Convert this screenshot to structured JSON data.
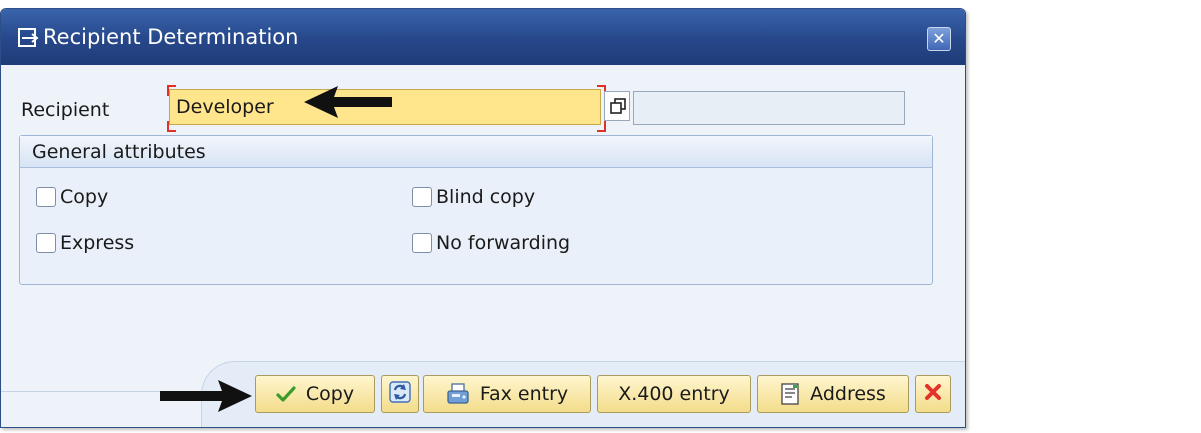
{
  "window": {
    "title": "Recipient Determination"
  },
  "recipient": {
    "label": "Recipient",
    "value": "Developer"
  },
  "group": {
    "title": "General attributes",
    "checkboxes": [
      {
        "label": "Copy",
        "checked": false
      },
      {
        "label": "Blind copy",
        "checked": false
      },
      {
        "label": "Express",
        "checked": false
      },
      {
        "label": "No forwarding",
        "checked": false
      }
    ]
  },
  "buttons": {
    "copy": "Copy",
    "fax": "Fax entry",
    "x400": "X.400 entry",
    "address": "Address"
  },
  "colors": {
    "title_bar": "#26478a",
    "input_highlight": "#ffe58c",
    "button_fill": "#f3dc8a",
    "required_marker": "#e0302a",
    "cancel_icon": "#e2342a"
  }
}
